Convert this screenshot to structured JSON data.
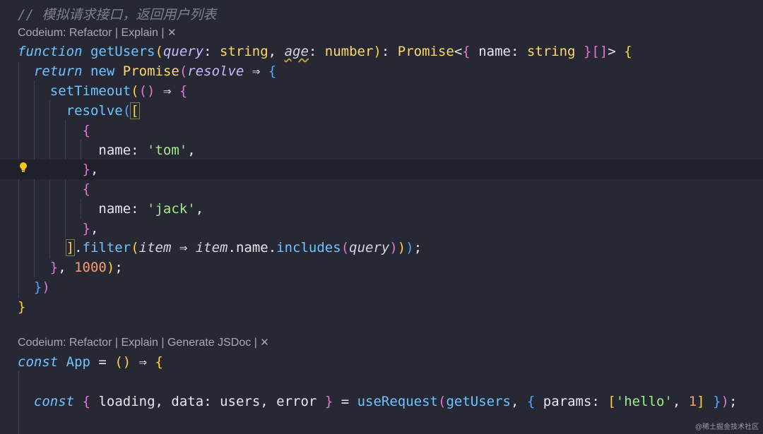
{
  "comment": "// 模拟请求接口，返回用户列表",
  "codelens1": {
    "prefix": "Codeium: ",
    "refactor": "Refactor",
    "sep": " | ",
    "explain": "Explain",
    "close": "✕"
  },
  "codelens2": {
    "prefix": "Codeium: ",
    "refactor": "Refactor",
    "sep": " | ",
    "explain": "Explain",
    "jsdoc": "Generate JSDoc",
    "close": "✕"
  },
  "code": {
    "function_kw": "function",
    "fn_name": "getUsers",
    "param_query": "query",
    "param_age": "age",
    "type_string": "string",
    "type_number": "number",
    "type_promise": "Promise",
    "field_name": "name",
    "return_kw": "return",
    "new_kw": "new",
    "resolve_param": "resolve",
    "set_timeout": "setTimeout",
    "resolve_call": "resolve",
    "tom": "'tom'",
    "jack": "'jack'",
    "filter": "filter",
    "item": "item",
    "includes": "includes",
    "delay": "1000",
    "const_kw": "const",
    "app_name": "App",
    "loading": "loading",
    "data": "data",
    "users": "users",
    "error": "error",
    "use_request": "useRequest",
    "get_users_ref": "getUsers",
    "params": "params",
    "hello": "'hello'",
    "one": "1"
  },
  "icons": {
    "lightbulb": "lightbulb-icon"
  },
  "watermark": "@稀土掘金技术社区"
}
